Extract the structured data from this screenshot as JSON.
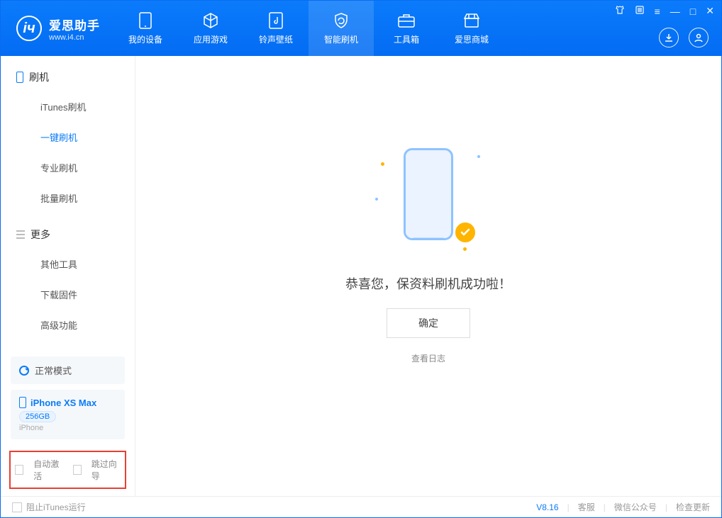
{
  "app": {
    "name_cn": "爱思助手",
    "url": "www.i4.cn"
  },
  "tabs": [
    {
      "label": "我的设备"
    },
    {
      "label": "应用游戏"
    },
    {
      "label": "铃声壁纸"
    },
    {
      "label": "智能刷机"
    },
    {
      "label": "工具箱"
    },
    {
      "label": "爱思商城"
    }
  ],
  "sidebar": {
    "section1_title": "刷机",
    "items1": [
      {
        "label": "iTunes刷机"
      },
      {
        "label": "一键刷机"
      },
      {
        "label": "专业刷机"
      },
      {
        "label": "批量刷机"
      }
    ],
    "section2_title": "更多",
    "items2": [
      {
        "label": "其他工具"
      },
      {
        "label": "下载固件"
      },
      {
        "label": "高级功能"
      }
    ]
  },
  "device_mode": "正常模式",
  "device": {
    "name": "iPhone XS Max",
    "storage": "256GB",
    "type": "iPhone"
  },
  "redbox": {
    "auto_activate": "自动激活",
    "skip_guide": "跳过向导"
  },
  "main": {
    "message": "恭喜您，保资料刷机成功啦！",
    "ok": "确定",
    "view_log": "查看日志"
  },
  "footer": {
    "block_itunes": "阻止iTunes运行",
    "version": "V8.16",
    "support": "客服",
    "wechat": "微信公众号",
    "check_update": "检查更新"
  }
}
